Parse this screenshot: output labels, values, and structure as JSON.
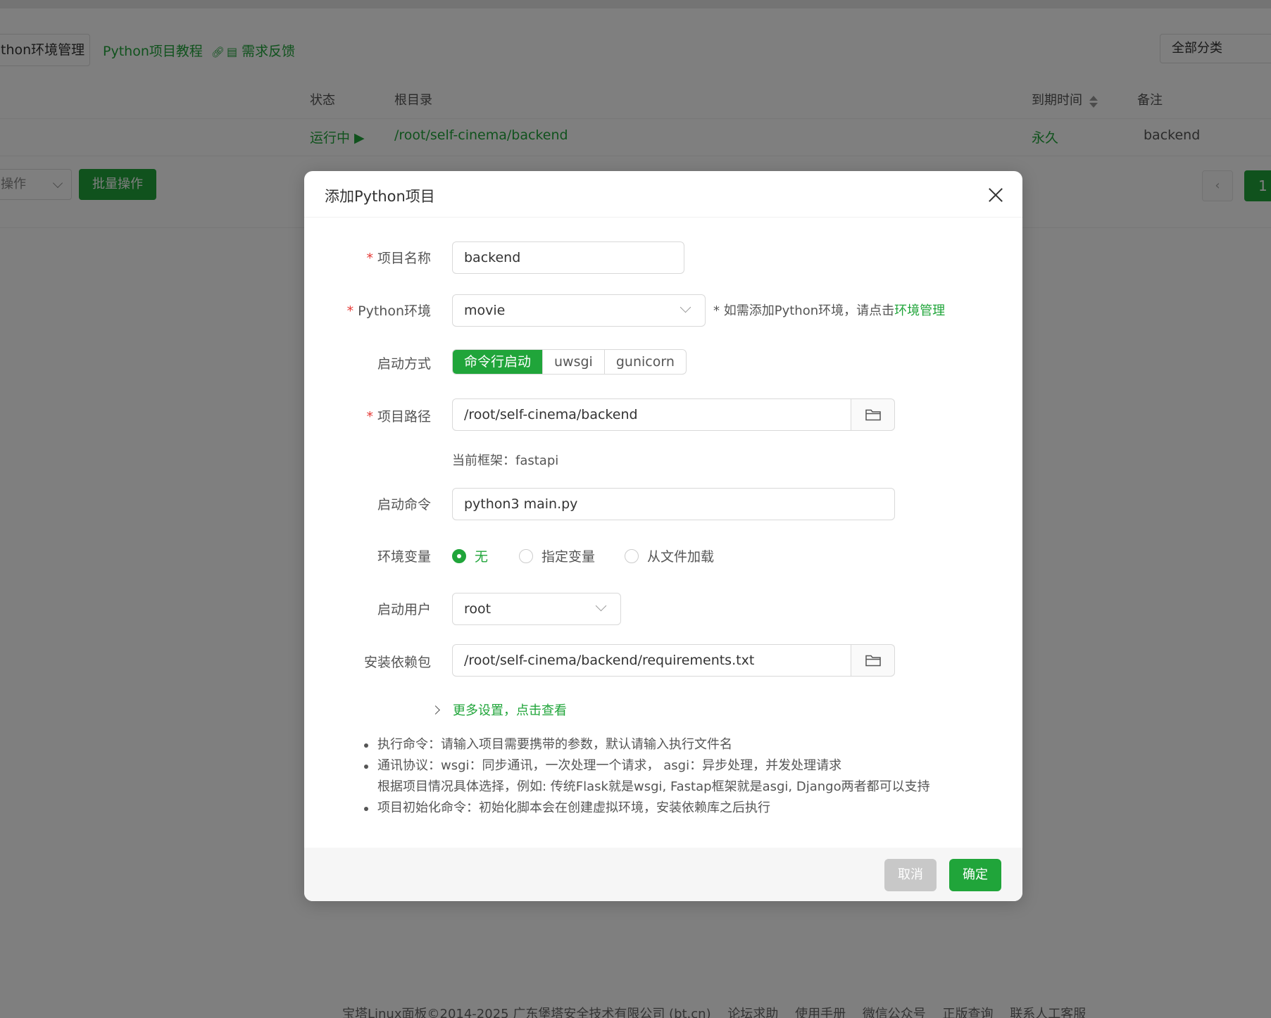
{
  "background": {
    "toolbar": {
      "env_btn": "thon环境管理",
      "tutorial_link": "Python项目教程",
      "feedback_link": "需求反馈",
      "category_select": "全部分类"
    },
    "table": {
      "headers": {
        "status": "状态",
        "root": "根目录",
        "expire": "到期时间",
        "note": "备注"
      },
      "row": {
        "status": "运行中",
        "root": "/root/self-cinema/backend",
        "expire": "永久",
        "note": "backend"
      }
    },
    "batch": {
      "op_select": "操作",
      "batch_button": "批量操作",
      "page_prev": "‹",
      "page_current": "1"
    },
    "footer": {
      "copyright": "宝塔Linux面板©2014-2025 广东堡塔安全技术有限公司 (bt.cn)",
      "links": [
        "论坛求助",
        "使用手册",
        "微信公众号",
        "正版查询",
        "联系人工客服"
      ]
    }
  },
  "dialog": {
    "title": "添加Python项目",
    "fields": {
      "name": {
        "label": "项目名称",
        "value": "backend"
      },
      "env": {
        "label": "Python环境",
        "value": "movie",
        "hint_prefix": "* 如需添加Python环境，请点击",
        "hint_link": "环境管理"
      },
      "start_mode": {
        "label": "启动方式",
        "options": [
          "命令行启动",
          "uwsgi",
          "gunicorn"
        ],
        "selected": "命令行启动"
      },
      "path": {
        "label": "项目路径",
        "value": "/root/self-cinema/backend",
        "framework": "当前框架：fastapi"
      },
      "command": {
        "label": "启动命令",
        "value": "python3 main.py"
      },
      "env_vars": {
        "label": "环境变量",
        "options": [
          "无",
          "指定变量",
          "从文件加载"
        ],
        "selected": "无"
      },
      "user": {
        "label": "启动用户",
        "value": "root"
      },
      "requirements": {
        "label": "安装依赖包",
        "value": "/root/self-cinema/backend/requirements.txt"
      }
    },
    "more_settings": "更多设置，点击查看",
    "notes": [
      "执行命令：请输入项目需要携带的参数，默认请输入执行文件名",
      "通讯协议：wsgi：同步通讯，一次处理一个请求， asgi：异步处理，并发处理请求",
      "根据项目情况具体选择，例如: 传统Flask就是wsgi, Fastap框架就是asgi, Django两者都可以支持",
      "项目初始化命令：初始化脚本会在创建虚拟环境，安装依赖库之后执行"
    ],
    "buttons": {
      "cancel": "取消",
      "ok": "确定"
    }
  },
  "colors": {
    "accent": "#20a53a",
    "required": "#e53935"
  }
}
